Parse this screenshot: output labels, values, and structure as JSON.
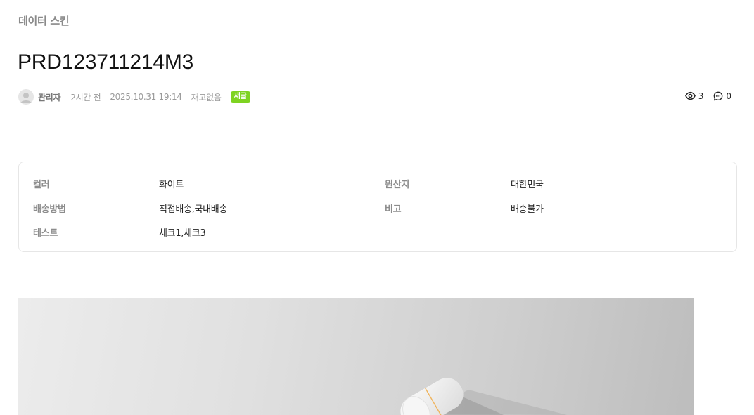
{
  "board": {
    "title": "데이터 스킨"
  },
  "post": {
    "title": "PRD123711214M3",
    "author": "관리자",
    "relative_time": "2시간 전",
    "datetime": "2025.10.31 19:14",
    "stock_status": "재고없음",
    "badge": "새글",
    "views": "3",
    "comments": "0"
  },
  "fields": [
    {
      "label": "컬러",
      "value": "화이트"
    },
    {
      "label": "원산지",
      "value": "대한민국"
    },
    {
      "label": "배송방법",
      "value": "직접배송,국내배송"
    },
    {
      "label": "비고",
      "value": "배송불가"
    },
    {
      "label": "테스트",
      "value": "체크1,체크3"
    }
  ],
  "colors": {
    "badge": "#7ed321",
    "label": "#8c8c8c",
    "border": "#e6e6e6"
  },
  "icons": {
    "views": "eye-icon",
    "comments": "comment-icon",
    "avatar": "user-icon"
  }
}
